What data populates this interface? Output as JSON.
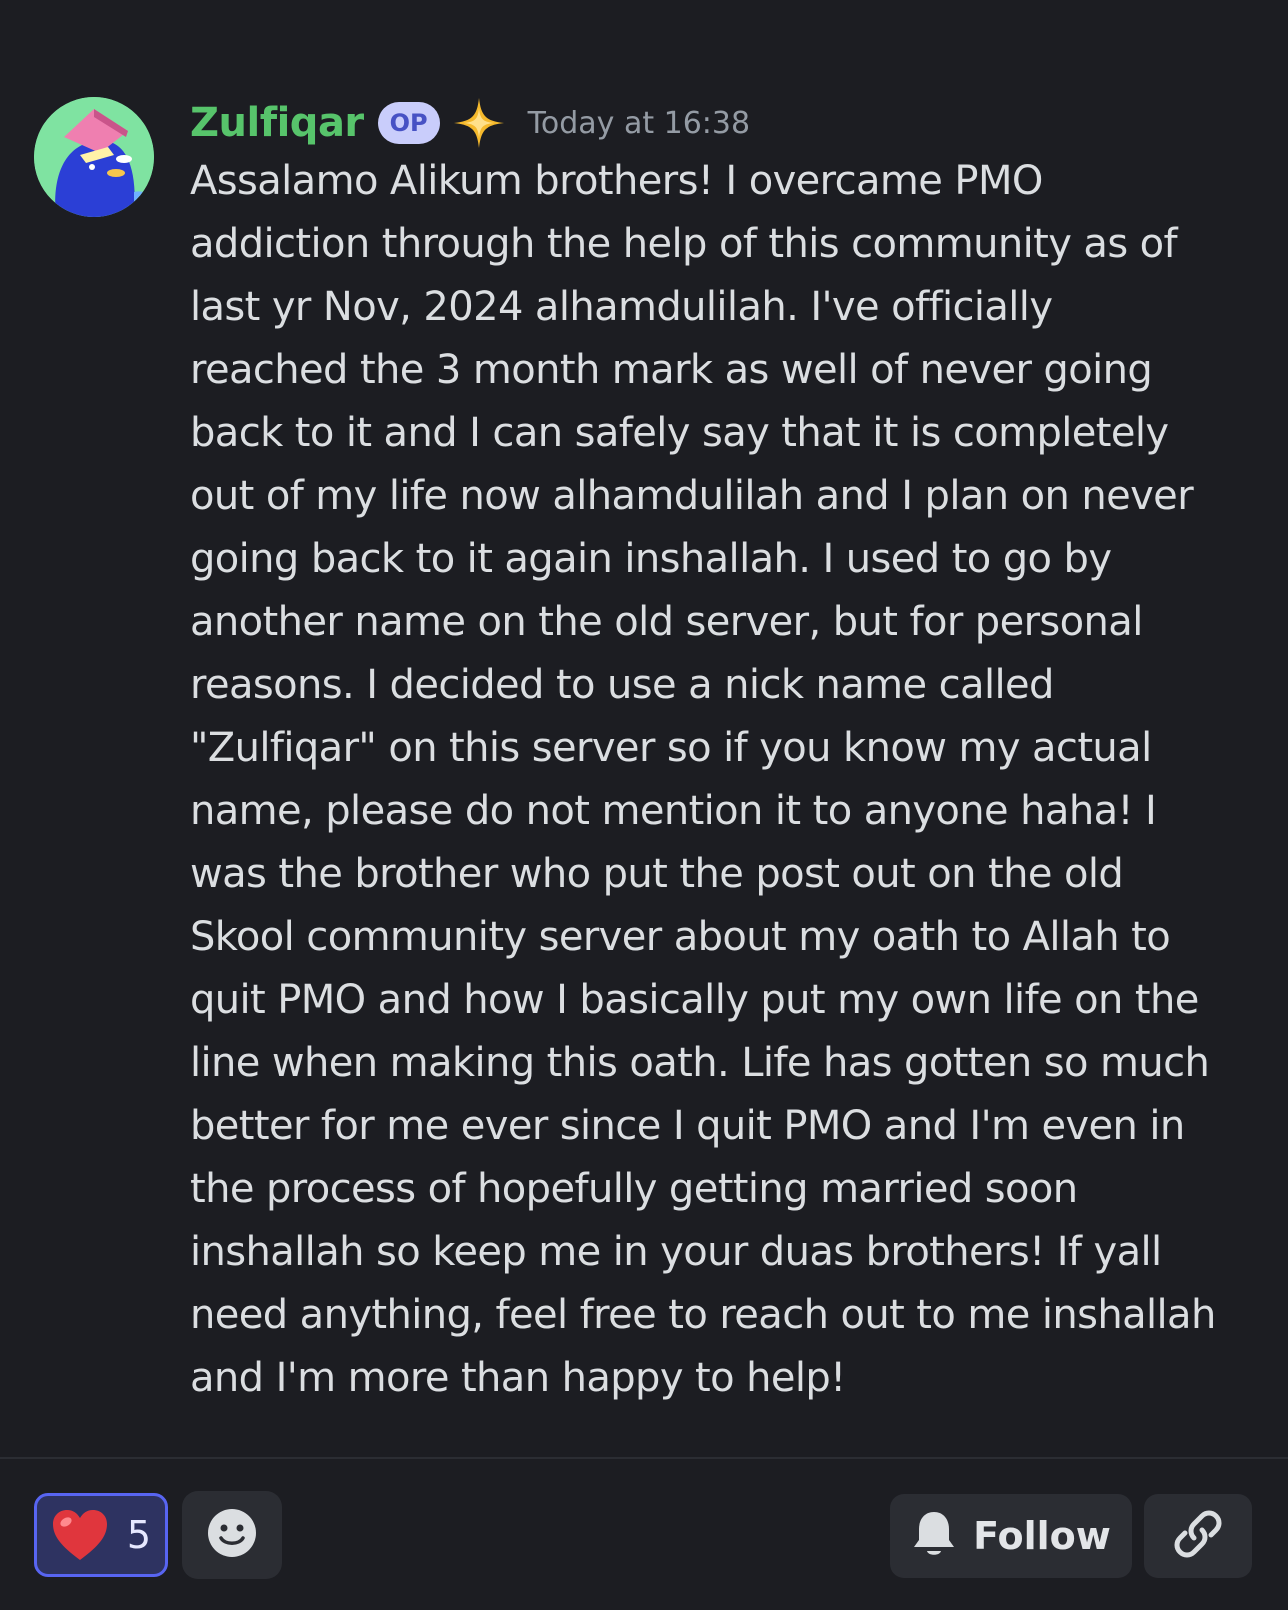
{
  "message": {
    "author": "Zulfiqar",
    "badge": "OP",
    "timestamp": "Today at 16:38",
    "lines": [
      "Assalamo Alikum brothers! I overcame PMO",
      "addiction through the help of this community as of",
      "last yr Nov, 2024 alhamdulilah. I've officially",
      "reached the 3 month mark as well of never going",
      "back to it and I can safely say that it is completely",
      "out of my life now alhamdulilah and I plan on never",
      "going back to it again inshallah. I used to go by",
      "another name on the old server, but for personal",
      "reasons. I decided to use a nick name called",
      "\"Zulfiqar\" on this server so if you know my actual",
      "name, please do not mention it to anyone haha! I",
      "was the brother who put the post out on the old",
      "Skool community server about my oath to Allah to",
      "quit PMO and how I basically put my own life on the",
      "line when making this oath. Life has gotten so much",
      "better for me ever since I quit PMO and I'm even in",
      "the process of hopefully getting married soon",
      "inshallah so keep me in your duas brothers! If yall",
      "need anything, feel free to reach out to me inshallah",
      "and I'm more than happy to help!"
    ]
  },
  "reactions": [
    {
      "emoji": "red-heart-icon",
      "count": "5"
    }
  ],
  "actions": {
    "follow_label": "Follow"
  },
  "colors": {
    "background": "#1c1d22",
    "username": "#57c46b",
    "accent": "#5865f2",
    "text": "#dbdee1",
    "muted": "#949ba4"
  },
  "icons": {
    "add_reaction": "smiley-icon",
    "follow": "bell-icon",
    "copy_link": "link-icon",
    "decoration": "sparkle-icon"
  }
}
